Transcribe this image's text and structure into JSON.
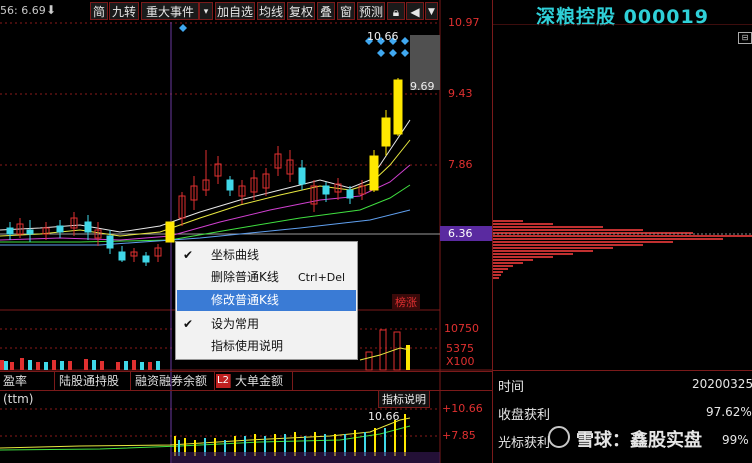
{
  "toolbar": {
    "partial_left": "56: 6.69",
    "buttons": [
      "简",
      "九转",
      "重大事件",
      "▾",
      "加自选",
      "均线",
      "复权",
      "叠",
      "窗",
      "预测",
      "",
      "",
      ""
    ]
  },
  "stock": {
    "name": "深粮控股",
    "code": "000019"
  },
  "price_axis": {
    "p1": "10.97",
    "p2": "9.43",
    "p3": "7.86",
    "p4": "6.36"
  },
  "volume_axis": {
    "v1": "10750",
    "v2": "5375",
    "v3": "X100"
  },
  "lower_axis": {
    "l1": "+10.66",
    "l2": "+7.85"
  },
  "chart_labels": {
    "high": "10.66",
    "high2": "9.69",
    "tag": "榜涨",
    "lower_high": "10.66",
    "explain_btn": "指标说明"
  },
  "context_menu": {
    "items": [
      {
        "label": "坐标曲线",
        "checked": true,
        "shortcut": "",
        "selected": false
      },
      {
        "label": "删除普通K线",
        "checked": false,
        "shortcut": "Ctrl+Del",
        "selected": false
      },
      {
        "label": "修改普通K线",
        "checked": false,
        "shortcut": "",
        "selected": true
      },
      {
        "label": "设为常用",
        "checked": true,
        "shortcut": "",
        "selected": false
      },
      {
        "label": "指标使用说明",
        "checked": false,
        "shortcut": "",
        "selected": false
      }
    ]
  },
  "tabs": [
    "盈率(ttm)",
    "陆股通持股",
    "融资融券余额",
    "L2",
    "大单金额"
  ],
  "info": {
    "time_label": "时间",
    "time_value": "20200325",
    "profit_label": "收盘获利",
    "profit_value": "97.62%",
    "cursor_label": "光标获利",
    "cursor_value": "99%"
  },
  "watermark": "雪球：鑫股实盘",
  "colors": {
    "up": "#ffe800",
    "down": "#40d8e8",
    "grid": "#7a1a1a",
    "price_red": "#e03030"
  }
}
